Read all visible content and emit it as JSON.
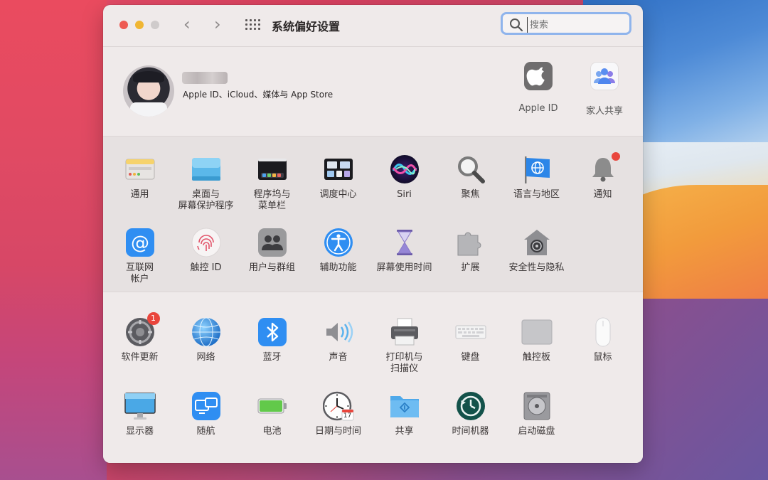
{
  "window": {
    "title": "系统偏好设置"
  },
  "search": {
    "placeholder": "搜索"
  },
  "profile": {
    "subtitle": "Apple ID、iCloud、媒体与 App Store"
  },
  "top_items": [
    {
      "label": "Apple ID",
      "icon": "apple-logo-icon"
    },
    {
      "label": "家人共享",
      "icon": "family-sharing-icon"
    }
  ],
  "section1": [
    {
      "label": "通用",
      "icon": "general-icon"
    },
    {
      "label": "桌面与\n屏幕保护程序",
      "icon": "desktop-screensaver-icon"
    },
    {
      "label": "程序坞与\n菜单栏",
      "icon": "dock-menubar-icon"
    },
    {
      "label": "调度中心",
      "icon": "mission-control-icon"
    },
    {
      "label": "Siri",
      "icon": "siri-icon"
    },
    {
      "label": "聚焦",
      "icon": "spotlight-icon"
    },
    {
      "label": "语言与地区",
      "icon": "language-region-icon"
    },
    {
      "label": "通知",
      "icon": "notifications-icon"
    },
    {
      "label": "互联网\n帐户",
      "icon": "internet-accounts-icon"
    },
    {
      "label": "触控 ID",
      "icon": "touch-id-icon"
    },
    {
      "label": "用户与群组",
      "icon": "users-groups-icon"
    },
    {
      "label": "辅助功能",
      "icon": "accessibility-icon"
    },
    {
      "label": "屏幕使用时间",
      "icon": "screen-time-icon"
    },
    {
      "label": "扩展",
      "icon": "extensions-icon"
    },
    {
      "label": "安全性与隐私",
      "icon": "security-privacy-icon"
    }
  ],
  "section2": [
    {
      "label": "软件更新",
      "icon": "software-update-icon",
      "badge": "1"
    },
    {
      "label": "网络",
      "icon": "network-icon"
    },
    {
      "label": "蓝牙",
      "icon": "bluetooth-icon"
    },
    {
      "label": "声音",
      "icon": "sound-icon"
    },
    {
      "label": "打印机与\n扫描仪",
      "icon": "printers-scanners-icon"
    },
    {
      "label": "键盘",
      "icon": "keyboard-icon"
    },
    {
      "label": "触控板",
      "icon": "trackpad-icon"
    },
    {
      "label": "鼠标",
      "icon": "mouse-icon"
    },
    {
      "label": "显示器",
      "icon": "displays-icon"
    },
    {
      "label": "随航",
      "icon": "sidecar-icon"
    },
    {
      "label": "电池",
      "icon": "battery-icon"
    },
    {
      "label": "日期与时间",
      "icon": "date-time-icon",
      "calendar_day": "17"
    },
    {
      "label": "共享",
      "icon": "sharing-icon"
    },
    {
      "label": "时间机器",
      "icon": "time-machine-icon"
    },
    {
      "label": "启动磁盘",
      "icon": "startup-disk-icon"
    }
  ]
}
